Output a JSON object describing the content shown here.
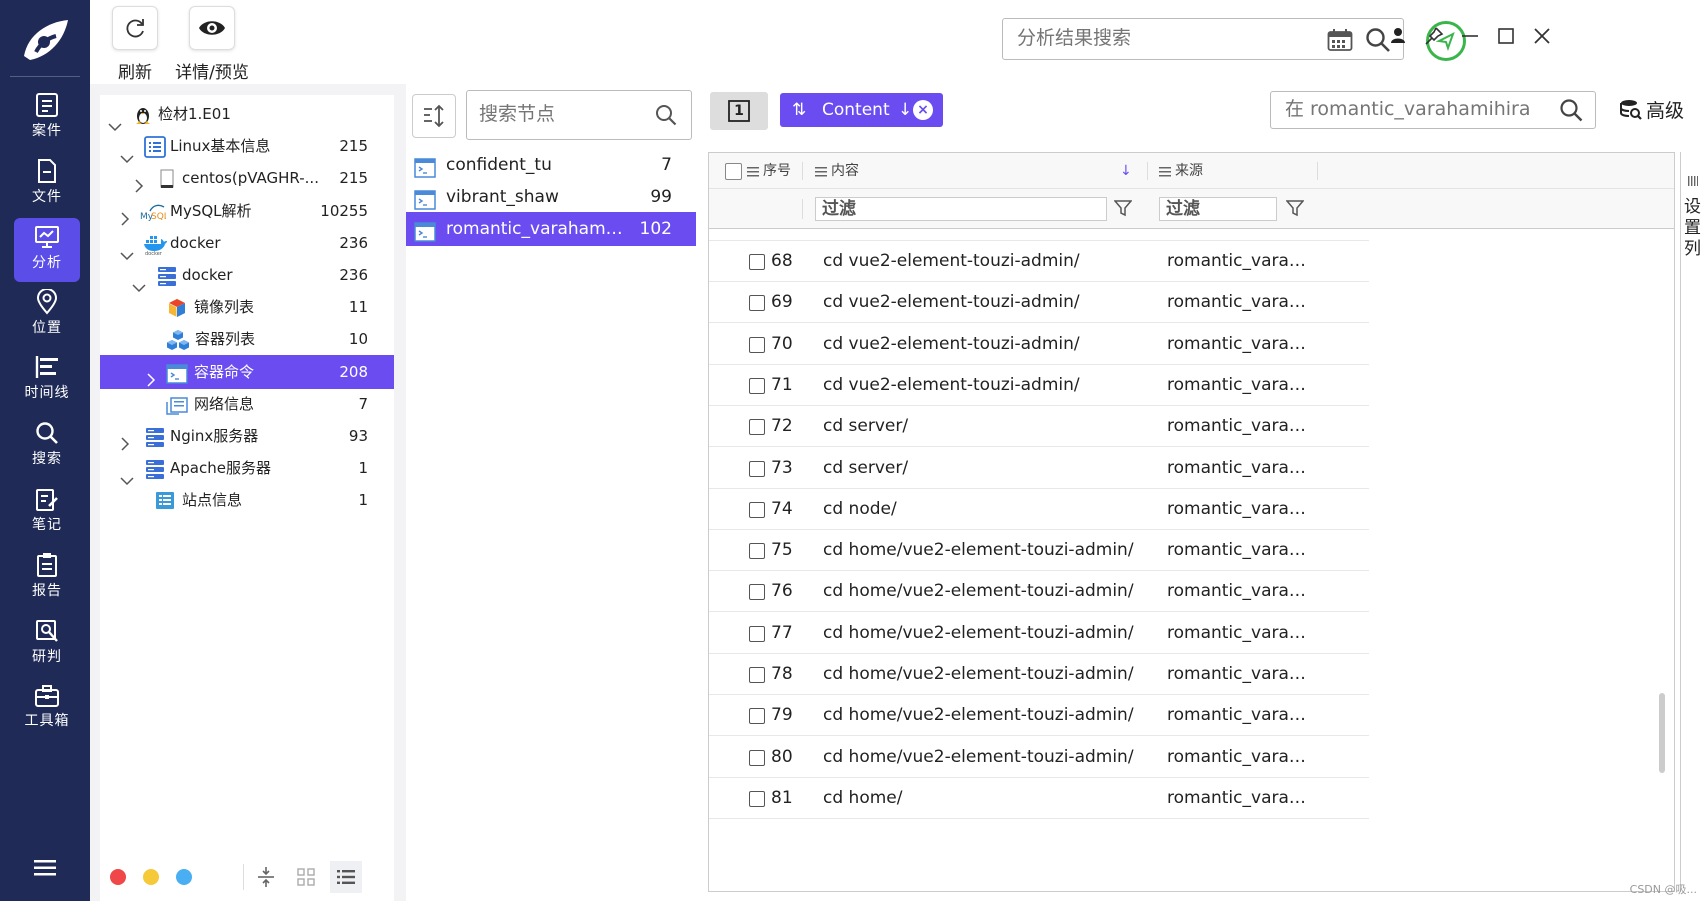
{
  "toolbar": {
    "refresh_label": "刷新",
    "preview_label": "详情/预览",
    "search_placeholder": "分析结果搜索"
  },
  "nav": {
    "items": [
      {
        "label": "案件",
        "icon": "case-icon"
      },
      {
        "label": "文件",
        "icon": "file-icon"
      },
      {
        "label": "分析",
        "icon": "analysis-icon",
        "active": true
      },
      {
        "label": "位置",
        "icon": "location-icon"
      },
      {
        "label": "时间线",
        "icon": "timeline-icon"
      },
      {
        "label": "搜索",
        "icon": "search-icon"
      },
      {
        "label": "笔记",
        "icon": "note-icon"
      },
      {
        "label": "报告",
        "icon": "report-icon"
      },
      {
        "label": "研判",
        "icon": "judgment-icon"
      },
      {
        "label": "工具箱",
        "icon": "toolbox-icon"
      }
    ]
  },
  "tree": {
    "rows": [
      {
        "label": "检材1.E01",
        "count": "",
        "icon": "linux-tux-icon",
        "expanded": true
      },
      {
        "label": "Linux基本信息",
        "count": "215",
        "icon": "list-icon",
        "expanded": true
      },
      {
        "label": "centos(pVAGHR-...",
        "count": "215",
        "icon": "disk-icon",
        "expanded": false
      },
      {
        "label": "MySQL解析",
        "count": "10255",
        "icon": "mysql-icon",
        "expanded": false
      },
      {
        "label": "docker",
        "count": "236",
        "icon": "docker-icon",
        "expanded": true
      },
      {
        "label": "docker",
        "count": "236",
        "icon": "server-icon",
        "expanded": true
      },
      {
        "label": "镜像列表",
        "count": "11",
        "icon": "cube-icon"
      },
      {
        "label": "容器列表",
        "count": "10",
        "icon": "cubes-icon"
      },
      {
        "label": "容器命令",
        "count": "208",
        "icon": "terminal-icon",
        "expanded": false,
        "selected": true
      },
      {
        "label": "网络信息",
        "count": "7",
        "icon": "network-icon"
      },
      {
        "label": "Nginx服务器",
        "count": "93",
        "icon": "server-icon",
        "expanded": false
      },
      {
        "label": "Apache服务器",
        "count": "1",
        "icon": "server-icon",
        "expanded": true
      },
      {
        "label": "站点信息",
        "count": "1",
        "icon": "site-icon"
      }
    ]
  },
  "legend_colors": [
    "#f04848",
    "#f6c938",
    "#4aaef2"
  ],
  "nodes": {
    "search_placeholder": "搜索节点",
    "rows": [
      {
        "label": "confident_tu",
        "count": "7"
      },
      {
        "label": "vibrant_shaw",
        "count": "99"
      },
      {
        "label": "romantic_varahamih...",
        "count": "102",
        "selected": true
      }
    ]
  },
  "main": {
    "num_label": "1",
    "tag_label": "Content",
    "search_placeholder": "在 romantic_varahamihira",
    "advanced_label": "高级",
    "columns": {
      "seq": "序号",
      "content": "内容",
      "source": "来源"
    },
    "filter_placeholder": "过滤",
    "settings_label": [
      "设",
      "置",
      "列"
    ],
    "rows": [
      {
        "seq": "68",
        "content": "cd vue2-element-touzi-admin/",
        "source": "romantic_varaham..."
      },
      {
        "seq": "69",
        "content": "cd vue2-element-touzi-admin/",
        "source": "romantic_varaham..."
      },
      {
        "seq": "70",
        "content": "cd vue2-element-touzi-admin/",
        "source": "romantic_varaham..."
      },
      {
        "seq": "71",
        "content": "cd vue2-element-touzi-admin/",
        "source": "romantic_varaham..."
      },
      {
        "seq": "72",
        "content": "cd server/",
        "source": "romantic_varaham..."
      },
      {
        "seq": "73",
        "content": "cd server/",
        "source": "romantic_varaham..."
      },
      {
        "seq": "74",
        "content": "cd node/",
        "source": "romantic_varaham..."
      },
      {
        "seq": "75",
        "content": "cd home/vue2-element-touzi-admin/",
        "source": "romantic_varaham..."
      },
      {
        "seq": "76",
        "content": "cd home/vue2-element-touzi-admin/",
        "source": "romantic_varaham..."
      },
      {
        "seq": "77",
        "content": "cd home/vue2-element-touzi-admin/",
        "source": "romantic_varaham..."
      },
      {
        "seq": "78",
        "content": "cd home/vue2-element-touzi-admin/",
        "source": "romantic_varaham..."
      },
      {
        "seq": "79",
        "content": "cd home/vue2-element-touzi-admin/",
        "source": "romantic_varaham..."
      },
      {
        "seq": "80",
        "content": "cd home/vue2-element-touzi-admin/",
        "source": "romantic_varaham..."
      },
      {
        "seq": "81",
        "content": "cd home/",
        "source": "romantic_varaham..."
      }
    ]
  },
  "credit": "CSDN @吸..."
}
